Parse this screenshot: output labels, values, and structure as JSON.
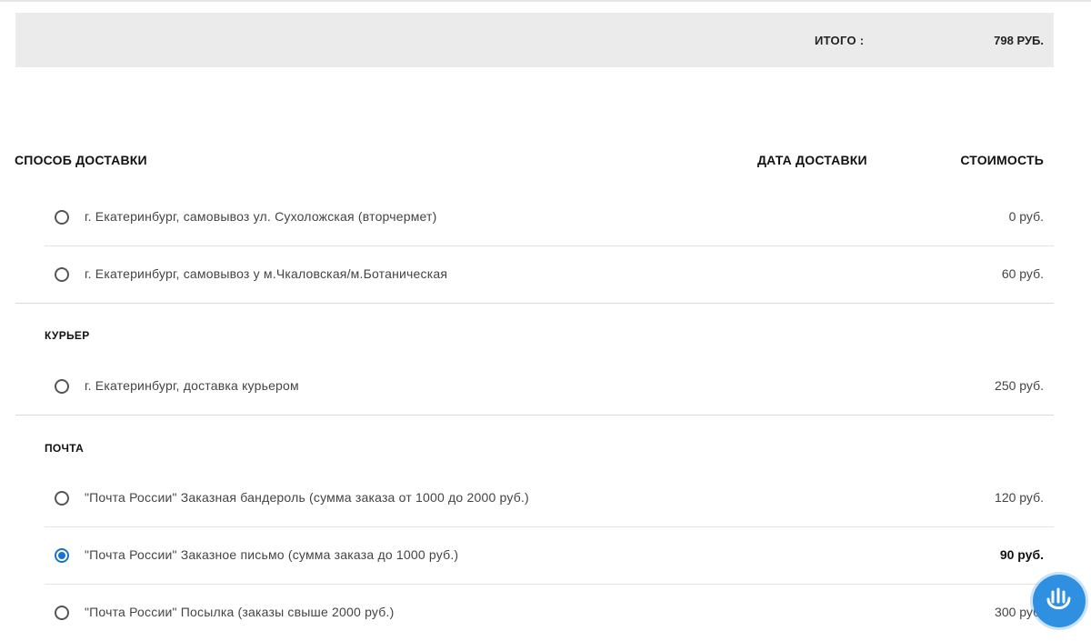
{
  "summary": {
    "total_label": "ИТОГО :",
    "total_value": "798 РУБ."
  },
  "table_header": {
    "method": "СПОСОБ ДОСТАВКИ",
    "date": "ДАТА ДОСТАВКИ",
    "cost": "СТОИМОСТЬ"
  },
  "pickup": [
    {
      "label": "г. Екатеринбург, самовывоз ул. Сухоложская (вторчермет)",
      "price": "0 руб.",
      "selected": false
    },
    {
      "label": "г. Екатеринбург, самовывоз у м.Чкаловская/м.Ботаническая",
      "price": "60 руб.",
      "selected": false
    }
  ],
  "courier": {
    "title": "КУРЬЕР",
    "items": [
      {
        "label": "г. Екатеринбург, доставка курьером",
        "price": "250 руб.",
        "selected": false
      }
    ]
  },
  "post": {
    "title": "ПОЧТА",
    "items": [
      {
        "label": "\"Почта России\" Заказная бандероль (сумма заказа от 1000 до 2000 руб.)",
        "price": "120 руб.",
        "selected": false
      },
      {
        "label": "\"Почта России\" Заказное письмо (сумма заказа до 1000 руб.)",
        "price": "90 руб.",
        "selected": true
      },
      {
        "label": "\"Почта России\" Посылка (заказы свыше 2000 руб.)",
        "price": "300 руб.",
        "selected": false
      }
    ]
  },
  "colors": {
    "accent": "#1a73c9",
    "help_button": "#2f8fe0",
    "summary_bg": "#ebebeb"
  },
  "icons": {
    "help": "hand-wave-icon"
  }
}
